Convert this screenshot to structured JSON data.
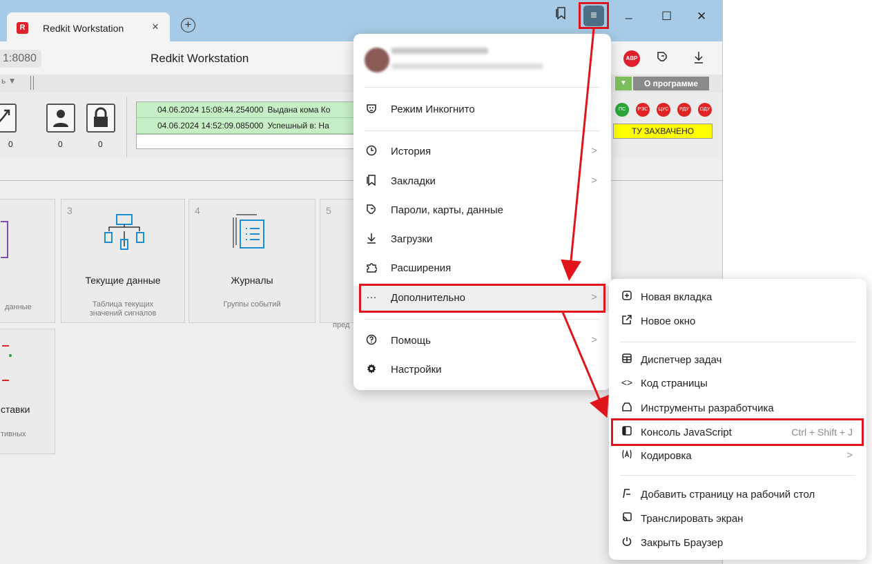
{
  "browser": {
    "tab_title": "Redkit Workstation",
    "tab_favicon_letter": "R",
    "tab_close": "×",
    "new_tab": "+",
    "menu_icon": "≡",
    "window_controls": {
      "minimize": "_",
      "maximize": "☐",
      "close": "✕"
    },
    "url_fragment": "1:8080",
    "page_title": "Redkit Workstation",
    "adblock_label": "ABP",
    "toolbar_icons": [
      "bookmarks-icon",
      "menu-icon",
      "passwords-icon",
      "download-icon"
    ]
  },
  "app": {
    "about_button": "О программе",
    "dropdown_arrow": "▼",
    "counters": [
      "0",
      "0",
      "0"
    ],
    "log": [
      {
        "time": "04.06.2024 15:08:44.254000",
        "text": "Выдана кома Ко"
      },
      {
        "time": "04.06.2024 14:52:09.085000",
        "text": "Успешный в: На"
      }
    ],
    "status_circles": [
      {
        "label": "ПС",
        "color": "#2aa63a"
      },
      {
        "label": "РЭС",
        "color": "#e02424"
      },
      {
        "label": "ЦУС",
        "color": "#e02424"
      },
      {
        "label": "РДУ",
        "color": "#e02424"
      },
      {
        "label": "ОДУ",
        "color": "#e02424"
      }
    ],
    "tu_status": "ТУ ЗАХВАЧЕНО",
    "tiles": [
      {
        "num": "",
        "name": "",
        "desc": "данные"
      },
      {
        "num": "3",
        "name": "Текущие данные",
        "desc": "Таблица текущих значений сигналов"
      },
      {
        "num": "4",
        "name": "Журналы",
        "desc": "Группы событий"
      },
      {
        "num": "5",
        "name": "",
        "desc": "пред"
      },
      {
        "num": "",
        "name": "ставки",
        "desc": "тивных"
      }
    ]
  },
  "menu": {
    "incognito": "Режим Инкогнито",
    "history": "История",
    "bookmarks": "Закладки",
    "passwords": "Пароли, карты, данные",
    "downloads": "Загрузки",
    "extensions": "Расширения",
    "more": "Дополнительно",
    "help": "Помощь",
    "settings": "Настройки",
    "chevron": ">"
  },
  "submenu": {
    "new_tab": "Новая вкладка",
    "new_window": "Новое окно",
    "task_manager": "Диспетчер задач",
    "page_source": "Код страницы",
    "dev_tools": "Инструменты разработчика",
    "js_console": "Консоль JavaScript",
    "js_console_shortcut": "Ctrl + Shift + J",
    "encoding": "Кодировка",
    "add_to_desktop": "Добавить страницу на рабочий стол",
    "cast": "Транслировать экран",
    "close_browser": "Закрыть Браузер",
    "chevron": ">"
  },
  "colors": {
    "highlight": "#e0141a",
    "menu_button": "#4d6f86",
    "tabstrip": "#a7cbe6"
  }
}
